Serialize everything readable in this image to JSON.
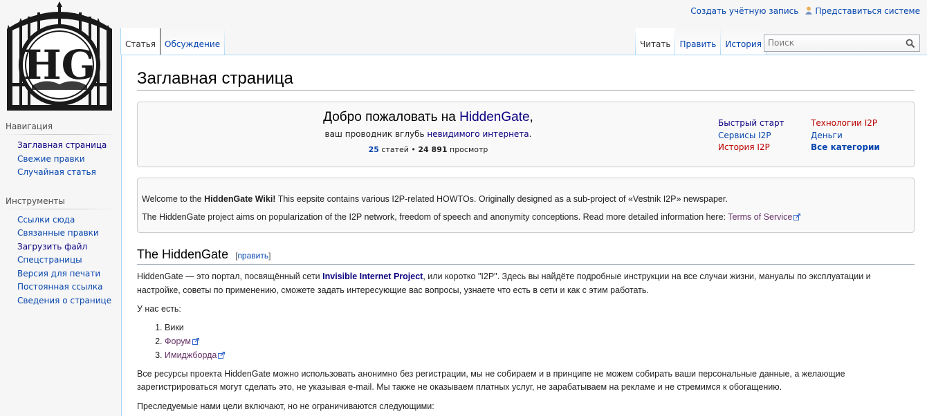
{
  "logo": {
    "letters": "HG"
  },
  "personal": {
    "create_account": "Создать учётную запись",
    "login": "Представиться системе"
  },
  "nav": {
    "heading": "Навигация",
    "items": [
      "Заглавная страница",
      "Свежие правки",
      "Случайная статья"
    ]
  },
  "tools": {
    "heading": "Инструменты",
    "items": [
      "Ссылки сюда",
      "Связанные правки",
      "Загрузить файл",
      "Спецстраницы",
      "Версия для печати",
      "Постоянная ссылка",
      "Сведения о странице"
    ]
  },
  "tabs": {
    "left": [
      "Статья",
      "Обсуждение"
    ],
    "right": [
      "Читать",
      "Править",
      "История"
    ]
  },
  "search": {
    "placeholder": "Поиск"
  },
  "page": {
    "title": "Заглавная страница",
    "welcome": {
      "prefix": "Добро пожаловать на ",
      "site": "HiddenGate",
      "suffix": ",",
      "sub_prefix": "ваш проводник вглубь ",
      "sub_link": "невидимого интернета",
      "sub_suffix": ".",
      "articles": "25",
      "articles_label": " статей • ",
      "views": "24 891",
      "views_label": " просмотр"
    },
    "quick_links": {
      "quick_start": "Быстрый старт",
      "technologies": "Технологии I2P",
      "services": "Сервисы I2P",
      "money": "Деньги",
      "history": "История I2P",
      "all_categories": "Все категории"
    },
    "intro": {
      "p1_prefix": "Welcome to the ",
      "p1_bold": "HiddenGate Wiki!",
      "p1_rest": " This eepsite contains various I2P-related HOWTOs. Originally designed as a sub-project of «Vestnik I2P» newspaper.",
      "p2_text": "The HiddenGate project aims on popularization of the I2P network, freedom of speech and anonymity conceptions. Read more detailed information here: ",
      "p2_link": "Terms of Service"
    },
    "section": {
      "heading": "The HiddenGate",
      "edit_open": "[",
      "edit_label": "править",
      "edit_close": "]",
      "p1_prefix": "HiddenGate — это портал, посвящённый сети ",
      "p1_link": "Invisible Internet Project",
      "p1_rest": ", или коротко \"I2P\". Здесь вы найдёте подробные инструкции на все случаи жизни, мануалы по эксплуатации и настройке, советы по применению, сможете задать интересующие вас вопросы, узнаете что есть в сети и как с этим работать.",
      "have_label": "У нас есть:",
      "list": [
        "Вики",
        "Форум",
        "Имиджборда"
      ],
      "p2": "Все ресурсы проекта HiddenGate можно использовать анонимно без регистрации, мы не собираем и в принципе не можем собирать ваши персональные данные, а желающие зарегистрироваться могут сделать это, не указывая e-mail. Мы также не оказываем платных услуг, не зарабатываем на рекламе и не стремимся к обогащению.",
      "p3": "Преследуемые нами цели включают, но не ограничиваются следующими:"
    }
  },
  "colors": {
    "link": "#0645ad",
    "visited": "#0b0080",
    "redlink": "#ba0000",
    "external": "#663366",
    "tab_border": "#a7d7f9"
  }
}
